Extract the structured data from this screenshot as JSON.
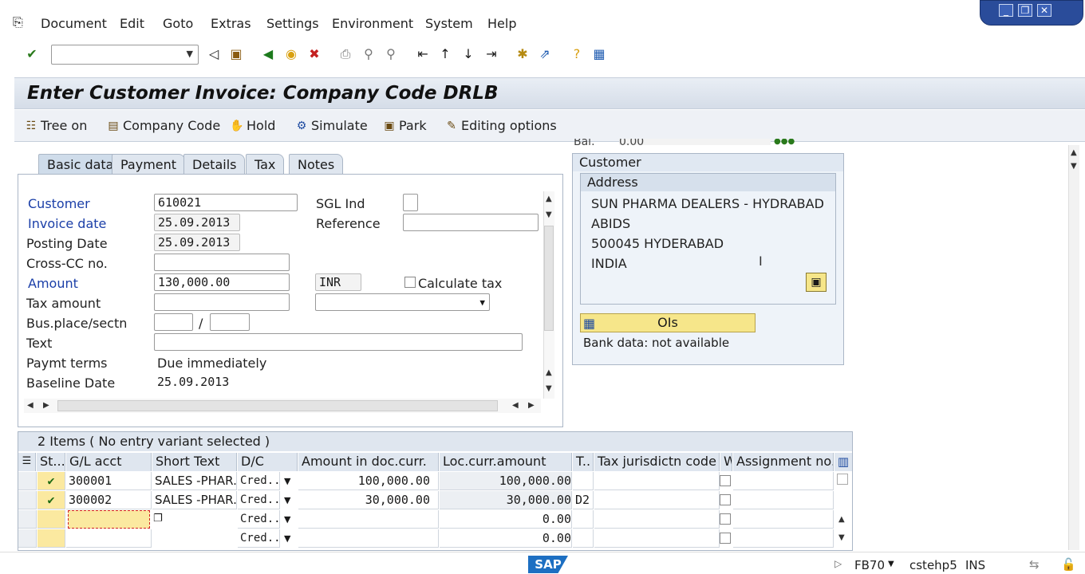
{
  "menu": [
    "Document",
    "Edit",
    "Goto",
    "Extras",
    "Settings",
    "Environment",
    "System",
    "Help"
  ],
  "title": "Enter Customer Invoice: Company Code DRLB",
  "app_toolbar": [
    "Tree on",
    "Company Code",
    "Hold",
    "Simulate",
    "Park",
    "Editing options"
  ],
  "bal": {
    "label": "Bal.",
    "value": "0.00"
  },
  "tabs": [
    "Basic data",
    "Payment",
    "Details",
    "Tax",
    "Notes"
  ],
  "basic": {
    "customer_label": "Customer",
    "customer": "610021",
    "sgl_label": "SGL Ind",
    "invoice_date_label": "Invoice date",
    "invoice_date": "25.09.2013",
    "reference_label": "Reference",
    "posting_date_label": "Posting Date",
    "posting_date": "25.09.2013",
    "crosscc_label": "Cross-CC no.",
    "amount_label": "Amount",
    "amount": "130,000.00",
    "currency": "INR",
    "calc_tax_label": "Calculate tax",
    "tax_amount_label": "Tax amount",
    "bus_place_label": "Bus.place/sectn",
    "slash": "/",
    "text_label": "Text",
    "paymt_terms_label": "Paymt terms",
    "paymt_terms": "Due immediately",
    "baseline_label": "Baseline Date",
    "baseline": "25.09.2013"
  },
  "customer": {
    "header": "Customer",
    "address_header": "Address",
    "address": [
      "SUN PHARMA DEALERS - HYDRABAD",
      "ABIDS",
      "500045 HYDERABAD",
      "INDIA"
    ],
    "oi_label": "OIs",
    "bank": "Bank data: not available"
  },
  "items": {
    "header": "2 Items ( No entry variant selected )",
    "columns": [
      "St...",
      "G/L acct",
      "Short Text",
      "D/C",
      "Amount in doc.curr.",
      "Loc.curr.amount",
      "T..",
      "Tax jurisdictn code",
      "W",
      "Assignment no."
    ],
    "rows": [
      {
        "status": "✔",
        "gl": "300001",
        "text": "SALES -PHAR...",
        "dc": "Cred...",
        "amount": "100,000.00",
        "loc": "100,000.00",
        "t": ""
      },
      {
        "status": "✔",
        "gl": "300002",
        "text": "SALES -PHAR...",
        "dc": "Cred...",
        "amount": "30,000.00",
        "loc": "30,000.00",
        "t": "D2"
      },
      {
        "status": "",
        "gl": "",
        "text": "",
        "dc": "Cred...",
        "amount": "",
        "loc": "0.00",
        "t": ""
      },
      {
        "status": "",
        "gl": "",
        "text": "",
        "dc": "Cred...",
        "amount": "",
        "loc": "0.00",
        "t": ""
      }
    ]
  },
  "status": {
    "tcode": "FB70",
    "server": "cstehp5",
    "mode": "INS",
    "logo": "SAP"
  }
}
